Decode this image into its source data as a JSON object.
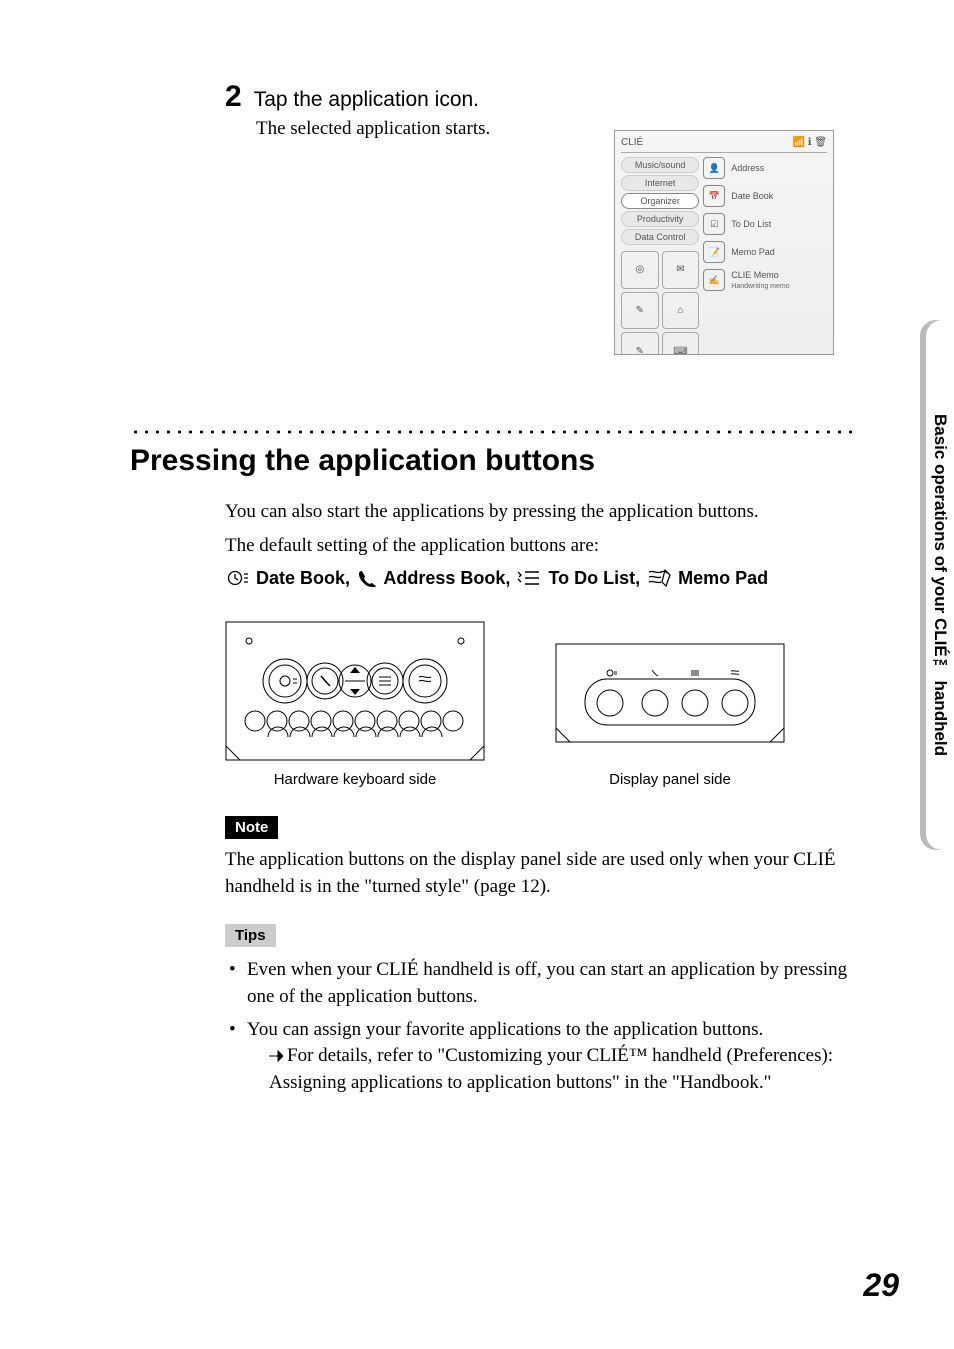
{
  "step": {
    "number": "2",
    "title": "Tap the application icon.",
    "subtitle": "The selected application starts."
  },
  "screenshot": {
    "brand": "CLIÉ",
    "categories": [
      "Music/sound",
      "Internet",
      "Organizer",
      "Productivity",
      "Data Control"
    ],
    "apps": [
      {
        "label": "Address"
      },
      {
        "label": "Date Book"
      },
      {
        "label": "To Do List"
      },
      {
        "label": "Memo Pad"
      },
      {
        "label": "CLIE Memo",
        "sub": "Handwriting memo"
      }
    ]
  },
  "section_heading": "Pressing the application buttons",
  "body": {
    "intro1": "You can also start the applications by pressing the application buttons.",
    "intro2": "The default setting of the application buttons are:",
    "defaults_parts": {
      "datebook": "Date Book",
      "addressbook": "Address Book",
      "todolist": "To Do List",
      "memopad": "Memo Pad"
    }
  },
  "figures": {
    "left_caption": "Hardware keyboard side",
    "right_caption": "Display panel side"
  },
  "note": {
    "label": "Note",
    "text": "The application buttons on the display panel side are used only when your CLIÉ handheld is in the \"turned style\" (page 12)."
  },
  "tips": {
    "label": "Tips",
    "items": [
      "Even when your CLIÉ handheld is off, you can start an application by pressing one of the application buttons.",
      "You can assign your favorite applications to the application buttons."
    ],
    "detail": "For details, refer to \"Customizing your CLIÉ™ handheld (Preferences): Assigning applications to application buttons\" in the \"Handbook.\""
  },
  "side_tab": "Basic operations of your CLIÉ™ handheld",
  "page_number": "29",
  "icon_names": {
    "clock": "datebook-icon",
    "phone": "addressbook-icon",
    "list": "todolist-icon",
    "memo": "memopad-icon"
  }
}
